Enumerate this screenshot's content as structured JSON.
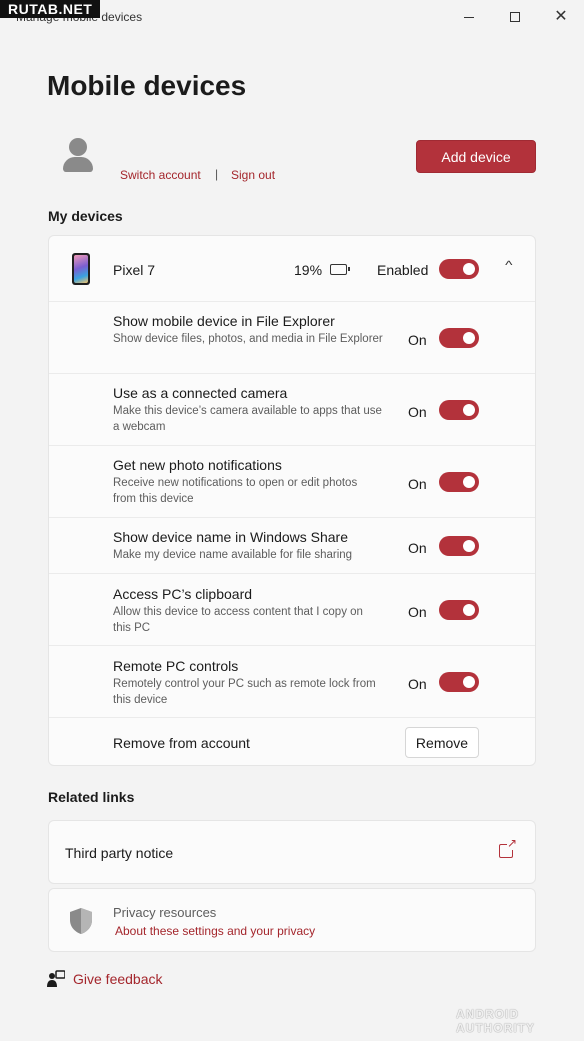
{
  "watermark_top": "RUTAB.NET",
  "window": {
    "title": "Manage mobile devices",
    "close_glyph": "✕"
  },
  "page_title": "Mobile devices",
  "account": {
    "switch_label": "Switch account",
    "separator": "|",
    "signout_label": "Sign out",
    "add_device_label": "Add device"
  },
  "my_devices_label": "My devices",
  "device": {
    "name": "Pixel 7",
    "battery": "19%",
    "enabled_label": "Enabled",
    "enabled": true,
    "chevron": "^"
  },
  "settings": [
    {
      "title": "Show mobile device in File Explorer",
      "desc": "Show device files, photos, and media in File Explorer",
      "state": "On",
      "on": true
    },
    {
      "title": "Use as a connected camera",
      "desc": "Make this device’s camera available to apps that use a webcam",
      "state": "On",
      "on": true
    },
    {
      "title": "Get new photo notifications",
      "desc": "Receive new notifications to open or edit photos from this device",
      "state": "On",
      "on": true
    },
    {
      "title": "Show device name in Windows Share",
      "desc": "Make my device name available for file sharing",
      "state": "On",
      "on": true
    },
    {
      "title": "Access PC’s clipboard",
      "desc": "Allow this device to access content that I copy on this PC",
      "state": "On",
      "on": true
    },
    {
      "title": "Remote PC controls",
      "desc": "Remotely control your PC such as remote lock from this device",
      "state": "On",
      "on": true
    }
  ],
  "remove": {
    "label": "Remove from account",
    "button": "Remove"
  },
  "related_links_label": "Related links",
  "third_party_label": "Third party notice",
  "privacy": {
    "title": "Privacy resources",
    "link": "About these settings and your privacy"
  },
  "feedback_label": "Give feedback",
  "watermark_bottom": "ANDROID AUTHORITY",
  "colors": {
    "accent": "#b3323b",
    "link": "#a4262c"
  }
}
